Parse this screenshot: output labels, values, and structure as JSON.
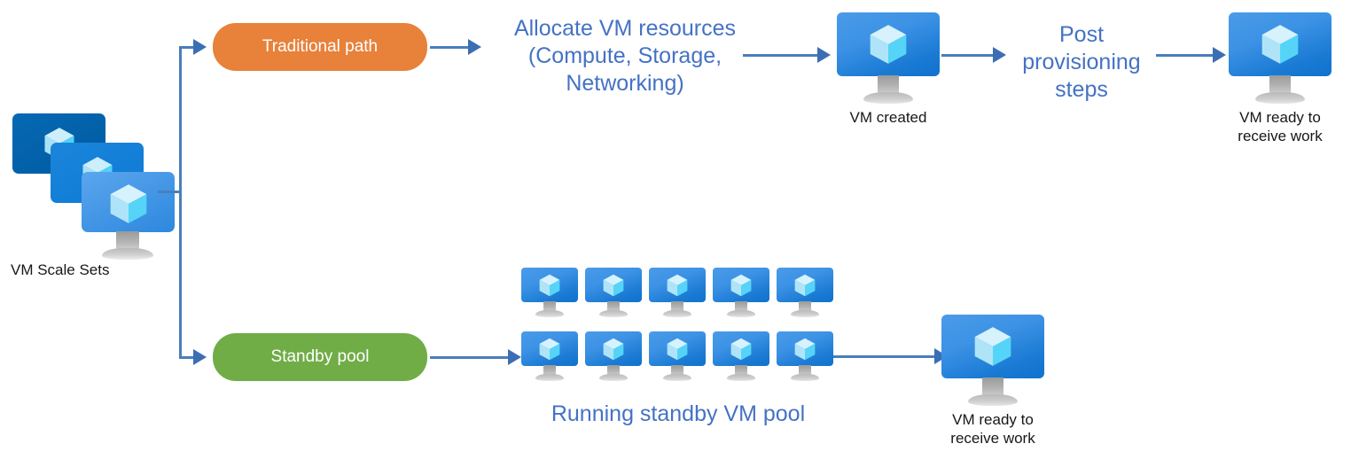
{
  "diagram": {
    "title": "Azure VM Scale Sets standby pool flow",
    "colors": {
      "accent_blue": "#4472C4",
      "line_blue": "#4A7EBB",
      "arrow_blue": "#3C6EB4",
      "orange": "#E8813A",
      "green": "#70AD47",
      "vm_screen_light": "#4B9BE8",
      "vm_screen_dark": "#0F72CD",
      "scaleset_back": "#005BA1",
      "scaleset_mid": "#0D7AD4",
      "scaleset_front": "#4B9BE8",
      "label_black": "#171717"
    }
  },
  "source": {
    "label": "VM Scale Sets",
    "icon": "vm-scale-sets-icon"
  },
  "paths": {
    "traditional": {
      "pill_label": "Traditional path",
      "step_text": "Allocate VM resources\n(Compute, Storage,\nNetworking)",
      "step_line1": "Allocate VM resources",
      "step_line2": "(Compute, Storage,",
      "step_line3": "Networking)",
      "vm_created_label": "VM created",
      "post_line1": "Post",
      "post_line2": "provisioning",
      "post_line3": "steps",
      "result_line1": "VM ready to",
      "result_line2": "receive work"
    },
    "standby": {
      "pill_label": "Standby pool",
      "pool_label": "Running standby VM pool",
      "pool_count": 10,
      "pool_rows": 2,
      "pool_columns": 5,
      "result_line1": "VM ready to",
      "result_line2": "receive work"
    }
  }
}
